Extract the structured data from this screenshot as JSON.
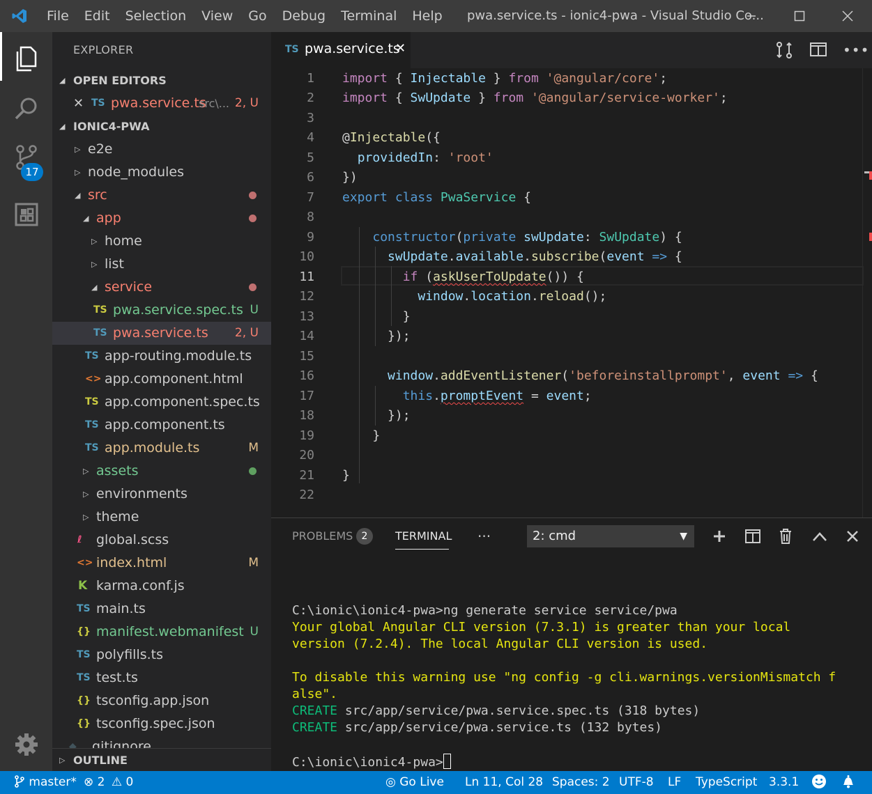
{
  "window": {
    "menu": [
      "File",
      "Edit",
      "Selection",
      "View",
      "Go",
      "Debug",
      "Terminal",
      "Help"
    ],
    "title": "pwa.service.ts - ionic4-pwa - Visual Studio Co..."
  },
  "activity": {
    "scm_badge": "17"
  },
  "sidebar": {
    "title": "EXPLORER",
    "open_editors_label": "OPEN EDITORS",
    "open_editor": {
      "icon": "TS",
      "name": "pwa.service.ts",
      "path": "src\\...",
      "status": "2, U"
    },
    "project_label": "IONIC4-PWA",
    "tree": [
      {
        "name": "e2e"
      },
      {
        "name": "node_modules"
      },
      {
        "name": "src"
      },
      {
        "name": "app"
      },
      {
        "name": "home"
      },
      {
        "name": "list"
      },
      {
        "name": "service"
      },
      {
        "icon": "TS",
        "name": "pwa.service.spec.ts",
        "status": "U"
      },
      {
        "icon": "TS",
        "name": "pwa.service.ts",
        "status": "2, U"
      },
      {
        "icon": "TS",
        "name": "app-routing.module.ts"
      },
      {
        "icon": "<>",
        "name": "app.component.html"
      },
      {
        "icon": "TS",
        "name": "app.component.spec.ts"
      },
      {
        "icon": "TS",
        "name": "app.component.ts"
      },
      {
        "icon": "TS",
        "name": "app.module.ts",
        "status": "M"
      },
      {
        "name": "assets"
      },
      {
        "name": "environments"
      },
      {
        "name": "theme"
      },
      {
        "icon": "ℓ",
        "name": "global.scss"
      },
      {
        "icon": "<>",
        "name": "index.html",
        "status": "M"
      },
      {
        "icon": "K",
        "name": "karma.conf.js"
      },
      {
        "icon": "TS",
        "name": "main.ts"
      },
      {
        "icon": "{}",
        "name": "manifest.webmanifest",
        "status": "U"
      },
      {
        "icon": "TS",
        "name": "polyfills.ts"
      },
      {
        "icon": "TS",
        "name": "test.ts"
      },
      {
        "icon": "{}",
        "name": "tsconfig.app.json"
      },
      {
        "icon": "{}",
        "name": "tsconfig.spec.json"
      },
      {
        "name": ".gitignore"
      }
    ],
    "outline_label": "OUTLINE"
  },
  "editor": {
    "tab": {
      "icon": "TS",
      "name": "pwa.service.ts"
    },
    "line_numbers": [
      "1",
      "2",
      "3",
      "4",
      "5",
      "6",
      "7",
      "8",
      "9",
      "10",
      "11",
      "12",
      "13",
      "14",
      "15",
      "16",
      "17",
      "18",
      "19",
      "20",
      "21",
      "22"
    ],
    "code": {
      "l1": [
        "import",
        " { ",
        "Injectable",
        " } ",
        "from",
        " ",
        "'@angular/core'",
        ";"
      ],
      "l2": [
        "import",
        " { ",
        "SwUpdate",
        " } ",
        "from",
        " ",
        "'@angular/service-worker'",
        ";"
      ],
      "l4": [
        "@",
        "Injectable",
        "({"
      ],
      "l5": [
        "  ",
        "providedIn",
        ": ",
        "'root'"
      ],
      "l6": [
        "})"
      ],
      "l7": [
        "export",
        " ",
        "class",
        " ",
        "PwaService",
        " {"
      ],
      "l9": [
        "    ",
        "constructor",
        "(",
        "private",
        " ",
        "swUpdate",
        ": ",
        "SwUpdate",
        ") {"
      ],
      "l10": [
        "      ",
        "swUpdate",
        ".",
        "available",
        ".",
        "subscribe",
        "(",
        "event",
        " ",
        "=>",
        " {"
      ],
      "l11": [
        "        ",
        "if",
        " (",
        "askUserToUpdate",
        "()",
        ") {"
      ],
      "l12": [
        "          ",
        "window",
        ".",
        "location",
        ".",
        "reload",
        "();"
      ],
      "l13": [
        "        }"
      ],
      "l14": [
        "      });"
      ],
      "l16": [
        "      ",
        "window",
        ".",
        "addEventListener",
        "(",
        "'beforeinstallprompt'",
        ", ",
        "event",
        " ",
        "=>",
        " {"
      ],
      "l17": [
        "        ",
        "this",
        ".",
        "promptEvent",
        " = ",
        "event",
        ";"
      ],
      "l18": [
        "      });"
      ],
      "l19": [
        "    }"
      ],
      "l21": [
        "}"
      ]
    }
  },
  "panel": {
    "tabs": {
      "problems": "PROBLEMS",
      "problems_count": "2",
      "terminal": "TERMINAL",
      "more": "···"
    },
    "terminal_select": "2: cmd",
    "terminal_lines": {
      "cmd": "C:\\ionic\\ionic4-pwa>ng generate service service/pwa",
      "warn1": "Your global Angular CLI version (7.3.1) is greater than your local",
      "warn2": "version (7.2.4). The local Angular CLI version is used.",
      "warn3": "To disable this warning use \"ng config -g cli.warnings.versionMismatch f",
      "warn4": "alse\".",
      "create_label": "CREATE",
      "create1": " src/app/service/pwa.service.spec.ts (318 bytes)",
      "create2": " src/app/service/pwa.service.ts (132 bytes)",
      "prompt": "C:\\ionic\\ionic4-pwa>"
    }
  },
  "status": {
    "branch": "master*",
    "errors": "2",
    "warnings": "0",
    "go_live": "Go Live",
    "position": "Ln 11, Col 28",
    "spaces": "Spaces: 2",
    "encoding": "UTF-8",
    "eol": "LF",
    "language": "TypeScript",
    "version": "3.3.1"
  },
  "colors": {
    "accent": "#007acc",
    "untracked": "#73c991",
    "modified": "#e2c08d",
    "error_file": "#f88070"
  }
}
